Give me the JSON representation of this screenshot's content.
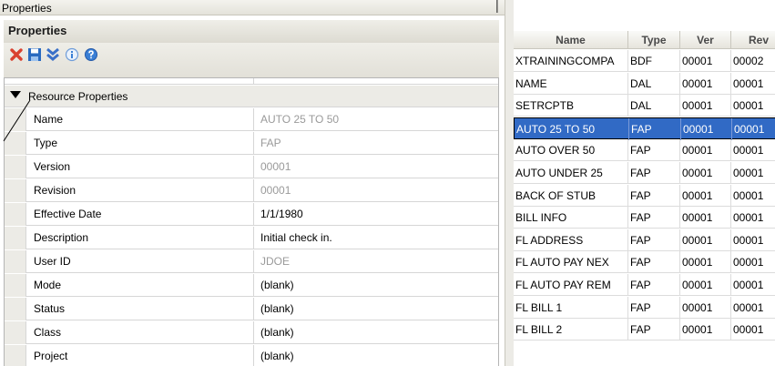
{
  "window": {
    "title": "Properties",
    "pin_glyph": "▕"
  },
  "panel": {
    "header": "Properties",
    "toolbar": [
      {
        "name": "delete-icon",
        "color": "#d9412f"
      },
      {
        "name": "save-icon",
        "color": "#2a6bc0"
      },
      {
        "name": "collapse-all-icon",
        "color": "#3a70c8"
      },
      {
        "name": "info-icon",
        "color": "#3a7fd5"
      },
      {
        "name": "help-icon",
        "color": "#3a7fd5"
      }
    ],
    "category": "Resource Properties",
    "properties": [
      {
        "name": "Name",
        "value": "AUTO 25 TO 50",
        "readonly": true
      },
      {
        "name": "Type",
        "value": "FAP",
        "readonly": true
      },
      {
        "name": "Version",
        "value": "00001",
        "readonly": true
      },
      {
        "name": "Revision",
        "value": "00001",
        "readonly": true
      },
      {
        "name": "Effective Date",
        "value": "1/1/1980",
        "readonly": false
      },
      {
        "name": "Description",
        "value": "Initial check in.",
        "readonly": false
      },
      {
        "name": "User ID",
        "value": "JDOE",
        "readonly": true
      },
      {
        "name": "Mode",
        "value": "(blank)",
        "readonly": false
      },
      {
        "name": "Status",
        "value": "(blank)",
        "readonly": false
      },
      {
        "name": "Class",
        "value": "(blank)",
        "readonly": false
      },
      {
        "name": "Project",
        "value": "(blank)",
        "readonly": false
      }
    ]
  },
  "resource_list": {
    "columns": [
      "Name",
      "Type",
      "Ver",
      "Rev"
    ],
    "rows": [
      {
        "name": "XTRAININGCOMPA",
        "type": "BDF",
        "ver": "00001",
        "rev": "00002",
        "selected": false
      },
      {
        "name": "NAME",
        "type": "DAL",
        "ver": "00001",
        "rev": "00001",
        "selected": false
      },
      {
        "name": "SETRCPTB",
        "type": "DAL",
        "ver": "00001",
        "rev": "00001",
        "selected": false
      },
      {
        "name": "AUTO 25 TO 50",
        "type": "FAP",
        "ver": "00001",
        "rev": "00001",
        "selected": true
      },
      {
        "name": "AUTO OVER 50",
        "type": "FAP",
        "ver": "00001",
        "rev": "00001",
        "selected": false
      },
      {
        "name": "AUTO UNDER 25",
        "type": "FAP",
        "ver": "00001",
        "rev": "00001",
        "selected": false
      },
      {
        "name": "BACK OF STUB",
        "type": "FAP",
        "ver": "00001",
        "rev": "00001",
        "selected": false
      },
      {
        "name": "BILL INFO",
        "type": "FAP",
        "ver": "00001",
        "rev": "00001",
        "selected": false
      },
      {
        "name": "FL ADDRESS",
        "type": "FAP",
        "ver": "00001",
        "rev": "00001",
        "selected": false
      },
      {
        "name": "FL AUTO PAY NEX",
        "type": "FAP",
        "ver": "00001",
        "rev": "00001",
        "selected": false
      },
      {
        "name": "FL AUTO PAY REM",
        "type": "FAP",
        "ver": "00001",
        "rev": "00001",
        "selected": false
      },
      {
        "name": "FL BILL 1",
        "type": "FAP",
        "ver": "00001",
        "rev": "00001",
        "selected": false
      },
      {
        "name": "FL BILL 2",
        "type": "FAP",
        "ver": "00001",
        "rev": "00001",
        "selected": false
      }
    ]
  }
}
